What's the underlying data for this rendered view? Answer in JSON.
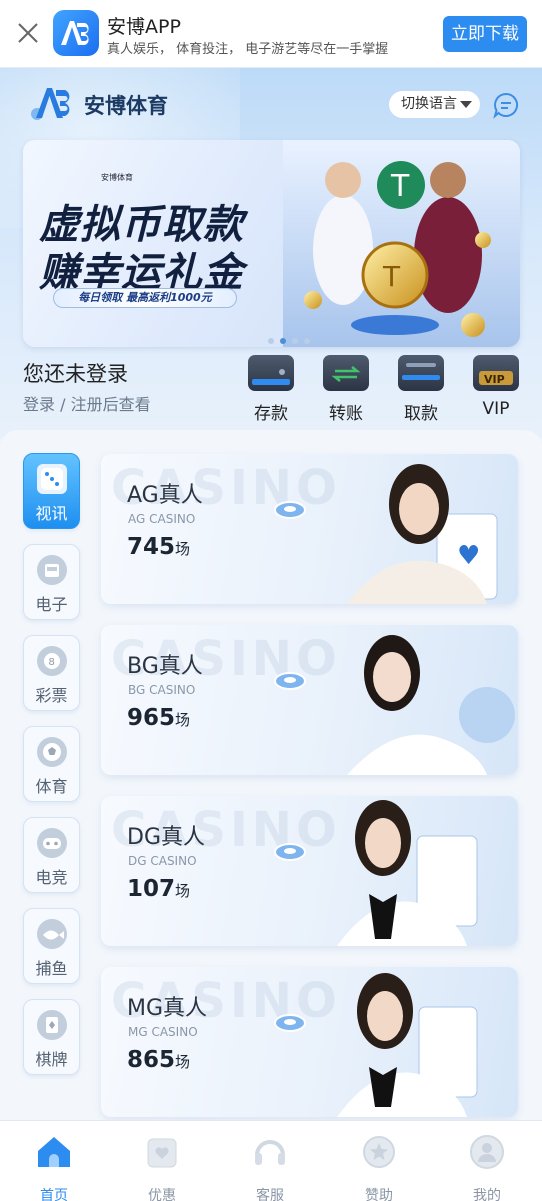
{
  "app_banner": {
    "title": "安博APP",
    "subtitle": "真人娱乐， 体育投注， 电子游艺等尽在一手掌握",
    "download_label": "立即下载"
  },
  "header": {
    "brand_name": "安博体育",
    "language_label": "切换语言"
  },
  "promo_banner": {
    "line1": "虚拟币取款",
    "line2": "赚幸运礼金",
    "pill": "每日领取  最高返利1000元",
    "small_brand": "安博体育",
    "active_dot": 1,
    "dot_count": 4
  },
  "login": {
    "title": "您还未登录",
    "subtitle": "登录 / 注册后查看"
  },
  "wallet_actions": [
    {
      "label": "存款",
      "icon": "wallet-deposit-icon"
    },
    {
      "label": "转账",
      "icon": "wallet-transfer-icon"
    },
    {
      "label": "取款",
      "icon": "wallet-withdraw-icon"
    },
    {
      "label": "VIP",
      "icon": "vip-icon"
    }
  ],
  "categories": [
    {
      "label": "视讯",
      "icon": "dice-icon",
      "active": true
    },
    {
      "label": "电子",
      "icon": "slot-machine-icon",
      "active": false
    },
    {
      "label": "彩票",
      "icon": "lottery-ball-icon",
      "active": false
    },
    {
      "label": "体育",
      "icon": "soccer-ball-icon",
      "active": false
    },
    {
      "label": "电竞",
      "icon": "gamepad-icon",
      "active": false
    },
    {
      "label": "捕鱼",
      "icon": "fish-icon",
      "active": false
    },
    {
      "label": "棋牌",
      "icon": "cards-icon",
      "active": false
    }
  ],
  "casino_cards": [
    {
      "title": "AG真人",
      "subtitle": "AG CASINO",
      "count": "745",
      "unit": "场",
      "watermark": "CASINO"
    },
    {
      "title": "BG真人",
      "subtitle": "BG CASINO",
      "count": "965",
      "unit": "场",
      "watermark": "CASINO"
    },
    {
      "title": "DG真人",
      "subtitle": "DG CASINO",
      "count": "107",
      "unit": "场",
      "watermark": "CASINO"
    },
    {
      "title": "MG真人",
      "subtitle": "MG CASINO",
      "count": "865",
      "unit": "场",
      "watermark": "CASINO"
    }
  ],
  "bottom_nav": [
    {
      "label": "首页",
      "icon": "home-icon",
      "active": true
    },
    {
      "label": "优惠",
      "icon": "gift-icon",
      "active": false
    },
    {
      "label": "客服",
      "icon": "headset-icon",
      "active": false
    },
    {
      "label": "赞助",
      "icon": "star-badge-icon",
      "active": false
    },
    {
      "label": "我的",
      "icon": "user-icon",
      "active": false
    }
  ],
  "colors": {
    "accent": "#2d8cf0",
    "active_category": "#1e8ff0",
    "text_dark": "#222222",
    "text_muted": "#8a96a5"
  }
}
